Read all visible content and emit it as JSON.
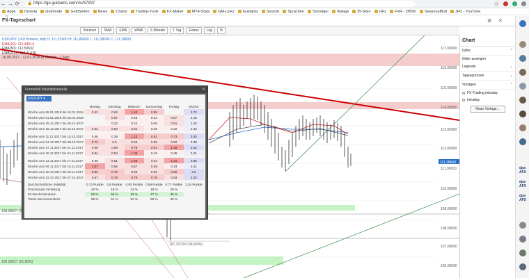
{
  "browser": {
    "url": "https://go.guidants.com/#c/57937",
    "bookmarks": [
      "Apps",
      "Onvista",
      "Godmode",
      "GoldSeiten",
      "News",
      "Charts",
      "Trading-Tools",
      "FX-Maker",
      "MT4-Stats",
      "GM-Links",
      "Guidants",
      "Sounds",
      "Sprachen",
      "Sonstiger",
      "Ablage",
      "IB-Sites",
      "GFs",
      "FXR - DBSK",
      "SeasonalBull",
      "JFD - YouTube"
    ]
  },
  "app": {
    "title": "FX-Tageschart",
    "toolbar": [
      "Volumen",
      "SMA",
      "EMA",
      "WMA",
      "6 Monate",
      "1 Tag",
      "Extras",
      "Log",
      "%"
    ]
  },
  "legend": {
    "symbol": "USD/JPY (JFD Brokers, bid) O: 111,22600 H: 111,86000 L: 111,08000 C: 111,28600",
    "ema20": "EMA(20): 112,44514",
    "ema50": "EMA(50): 112,59532",
    "ema100": "EMA(100): 112,41476",
    "range": "16.05.2017 - 12.01.2018 (6 Monate - 1 Tag)"
  },
  "y_axis": {
    "ticks": [
      "117,00000",
      "116,00000",
      "115,00000",
      "114,00000",
      "113,00000",
      "112,00000",
      "111,00000",
      "110,00000",
      "109,00000",
      "108,00000",
      "107,00000",
      "106,00000"
    ],
    "current_price": "111,28600"
  },
  "annotations": {
    "fib_low_label": "107,31700 (100,00%)",
    "fib_left_1": "108,09527 (0...",
    "fib_left_2": "106,09527 (61,80%)"
  },
  "right_panel": {
    "title": "Chart",
    "sections": [
      "Gitter",
      "Legende",
      "Tagesgrenzen",
      "Vorlagen"
    ],
    "grid_option": "Gitter anzeigen",
    "templates": [
      "FX-Trading intraday",
      "Intraday"
    ],
    "new_button": "Neue Vorlage..."
  },
  "popup": {
    "title": "Formelfull Volatilitätstabelle",
    "symbol": "USD/JPY",
    "headers": [
      "Montag",
      "Dienstag",
      "Mittwoch",
      "Donnerstag",
      "Freitag",
      "Woche"
    ],
    "weeks": [
      {
        "label": "Woche vom 08.01.2018 bis 12.01.2018",
        "values": [
          "0.52",
          "0.62",
          "1.53",
          "0.95",
          "",
          "3.72"
        ]
      },
      {
        "label": "Woche vom 01.01.2018 bis 05.01.2018",
        "values": [
          "",
          "0.67",
          "0.45",
          "0.42",
          "0.67",
          "2.16"
        ]
      },
      {
        "label": "Woche vom 25.12.2017 bis 29.12.2017",
        "values": [
          "",
          "0.22",
          "0.24",
          "0.05",
          "0.51",
          "1.02"
        ]
      },
      {
        "label": "Woche vom 18.12.2017 bis 22.12.2017",
        "values": [
          "0.53",
          "0.50",
          "0.64",
          "0.45",
          "0.22",
          "2.42"
        ]
      },
      {
        "label": "Woche vom 11.12.2017 bis 15.12.2017",
        "values": [
          "0.46",
          "0.39",
          "1.13",
          "0.82",
          "0.73",
          "3.53"
        ]
      },
      {
        "label": "Woche vom 04.12.2017 bis 08.12.2017",
        "values": [
          "0.73",
          "0.5",
          "0.66",
          "0.55",
          "0.52",
          "3.38"
        ]
      },
      {
        "label": "Woche vom 27.11.2017 bis 01.12.2017",
        "values": [
          "0.66",
          "0.59",
          "0.78",
          "0.91",
          "1.49",
          "4.62"
        ]
      },
      {
        "label": "Woche vom 20.11.2017 bis 24.11.2017",
        "values": [
          "0.64",
          "0.54",
          "1.36",
          "0.19",
          "0.46",
          "3.41"
        ]
      },
      {
        "label": "Woche vom 13.11.2017 bis 17.11.2017",
        "values": [
          "0.49",
          "0.61",
          "1.03",
          "0.61",
          "1.21",
          "3.95"
        ]
      },
      {
        "label": "Woche vom 06.11.2017 bis 10.11.2017",
        "values": [
          "1.07",
          "0.65",
          "0.67",
          "0.59",
          "0.43",
          "3.41"
        ]
      },
      {
        "label": "Woche vom 30.10.2017 bis 03.11.2017",
        "values": [
          "0.82",
          "0.78",
          "0.69",
          "0.69",
          "0.82",
          "3.6"
        ]
      },
      {
        "label": "Woche vom 23.10.2017 bis 27.10.2017",
        "values": [
          "0.67",
          "0.79",
          "0.79",
          "0.75",
          "0.63",
          "4.02"
        ]
      }
    ],
    "summary": [
      {
        "label": "Durchschnittliche Volatilität",
        "values": [
          "0.72 Punkte",
          "0.6 Punkte",
          "0.93 Punkte",
          "0.59 Punkte",
          "0.71 Punkte",
          "3.34 Punkte"
        ]
      },
      {
        "label": "Prozentuale Verteilung",
        "values": [
          "20 %",
          "18 %",
          "23 %",
          "19 %",
          "20 %",
          ""
        ]
      },
      {
        "label": "52-Wochentendenz",
        "values": [
          "50 %",
          "59 %",
          "39 %",
          "47 %",
          "35 %",
          ""
        ]
      },
      {
        "label": "Totale Wochentendenz",
        "values": [
          "55 %",
          "51 %",
          "52 %",
          "50 %",
          "40 %",
          ""
        ]
      }
    ]
  }
}
